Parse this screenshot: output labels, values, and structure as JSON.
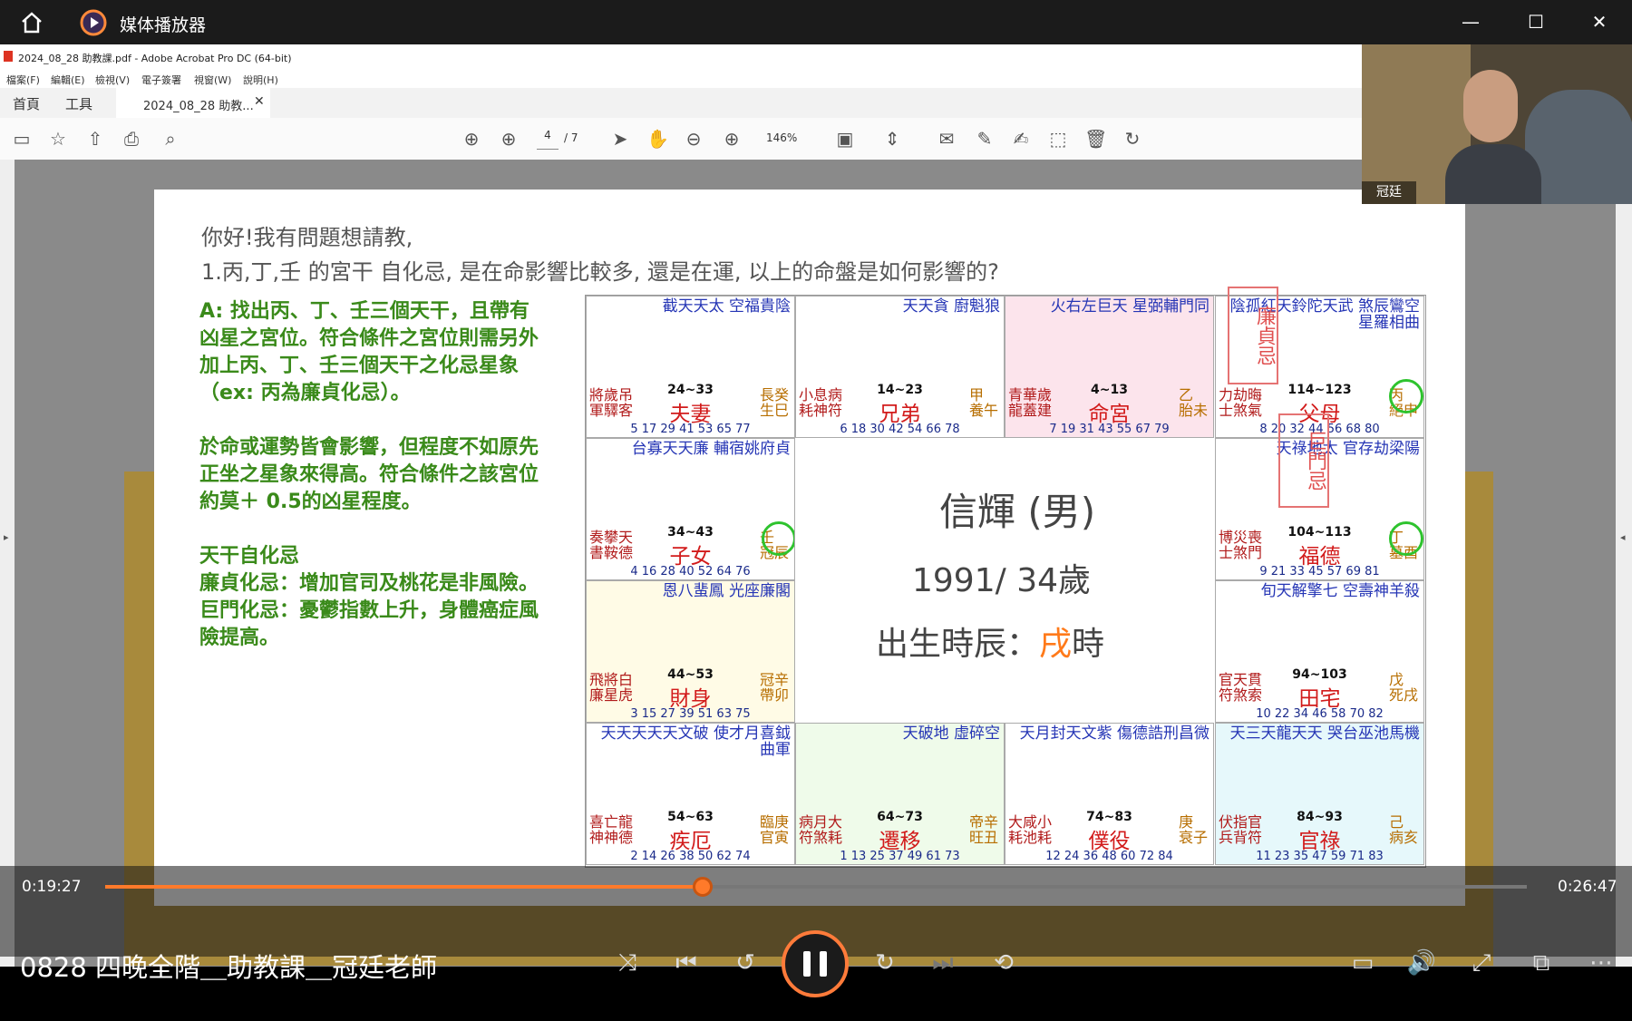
{
  "player": {
    "title": "媒体播放器",
    "video_title": "0828 四晚全階＿助教課＿冠廷老師",
    "elapsed": "0:19:27",
    "duration": "0:26:47",
    "progress": 0.42,
    "accent": "#ff7a2a",
    "window_buttons": [
      "—",
      "☐",
      "✕"
    ]
  },
  "acrobat": {
    "window_title": "2024_08_28 助教課.pdf - Adobe Acrobat Pro DC (64-bit)",
    "menu": [
      "檔案(F)",
      "編輯(E)",
      "檢視(V)",
      "電子簽署",
      "視窗(W)",
      "說明(H)"
    ],
    "tabs": [
      "首頁",
      "工具",
      "2024_08_28 助教..."
    ],
    "page": "4",
    "page_total": "/ 7",
    "zoom": "146%"
  },
  "webcam": {
    "name": "冠廷"
  },
  "slide": {
    "question_1": "你好!我有問題想請教,",
    "question_2": "1.丙,丁,壬 的宮干 自化忌, 是在命影響比較多, 還是在運, 以上的命盤是如何影響的?",
    "answer_1": "A: 找出丙、丁、壬三個天干，且帶有凶星之宮位。符合條件之宮位則需另外加上丙、丁、壬三個天干之化忌星象（ex: 丙為廉貞化忌）。",
    "answer_2": "於命或運勢皆會影響，但程度不如原先正坐之星象來得高。符合條件之該宮位約莫＋ 0.5的凶星程度。",
    "answer_3": "天干自化忌",
    "answer_4": "廉貞化忌：增加官司及桃花是非風險。",
    "answer_5": "巨門化忌：憂鬱指數上升，身體癌症風險提高。",
    "center_name": "信輝 (男)",
    "center_year": "1991/ 34歲",
    "center_hour_label": "出生時辰：",
    "center_hour_value": "戌",
    "center_hour_suffix": "時",
    "box_1": "廉貞忌",
    "box_2": "巨門忌",
    "palaces": [
      {
        "name": "夫妻",
        "range": "24~33",
        "stars": "截天天太 空福貴陰",
        "left": "將歲吊 軍驛客",
        "right": "長癸 生巳",
        "years": "5 17 29 41 53 65 77"
      },
      {
        "name": "兄弟",
        "range": "14~23",
        "stars": "天天貪 廚魁狼",
        "left": "小息病 耗神符",
        "right": "甲 養午",
        "years": "6 18 30 42 54 66 78"
      },
      {
        "name": "命宮",
        "range": "4~13",
        "stars": "火右左巨天 星弼輔門同",
        "left": "青華歲 龍蓋建",
        "right": "乙 胎未",
        "years": "7 19 31 43 55 67 79"
      },
      {
        "name": "父母",
        "range": "114~123",
        "stars": "陰孤紅天鈴陀天武 煞辰鸞空星羅相曲",
        "left": "力劫晦 士煞氣",
        "right": "丙 絕申",
        "years": "8 20 32 44 56 68 80"
      },
      {
        "name": "子女",
        "range": "34~43",
        "stars": "台寡天天廉 輔宿姚府貞",
        "left": "奏攀天 書鞍德",
        "right": "壬 冠辰",
        "years": "4 16 28 40 52 64 76"
      },
      {
        "name": "福德",
        "range": "104~113",
        "stars": "天祿地太 官存劫梁陽",
        "left": "博災喪 士煞門",
        "right": "丁 墓酉",
        "years": "9 21 33 45 57 69 81"
      },
      {
        "name": "財身",
        "range": "44~53",
        "stars": "恩八蜚鳳 光座廉閣",
        "left": "飛將白 廉星虎",
        "right": "冠辛 帶卯",
        "years": "3 15 27 39 51 63 75"
      },
      {
        "name": "田宅",
        "range": "94~103",
        "stars": "旬天解擎七 空壽神羊殺",
        "left": "官天貫 符煞索",
        "right": "戊 死戌",
        "years": "10 22 34 46 58 70 82"
      },
      {
        "name": "疾厄",
        "range": "54~63",
        "stars": "天天天天天文破 使才月喜鉞曲軍",
        "left": "喜亡龍 神神德",
        "right": "臨庚 官寅",
        "years": "2 14 26 38 50 62 74"
      },
      {
        "name": "遷移",
        "range": "64~73",
        "stars": "天破地 虛碎空",
        "left": "病月大 符煞耗",
        "right": "帝辛 旺丑",
        "years": "1 13 25 37 49 61 73"
      },
      {
        "name": "僕役",
        "range": "74~83",
        "stars": "天月封天文紫 傷德誥刑昌微",
        "left": "大咸小 耗池耗",
        "right": "庚 衰子",
        "years": "12 24 36 48 60 72 84"
      },
      {
        "name": "官祿",
        "range": "84~93",
        "stars": "天三天龍天天 哭台巫池馬機",
        "left": "伏指官 兵背符",
        "right": "己 病亥",
        "years": "11 23 35 47 59 71 83"
      }
    ]
  }
}
